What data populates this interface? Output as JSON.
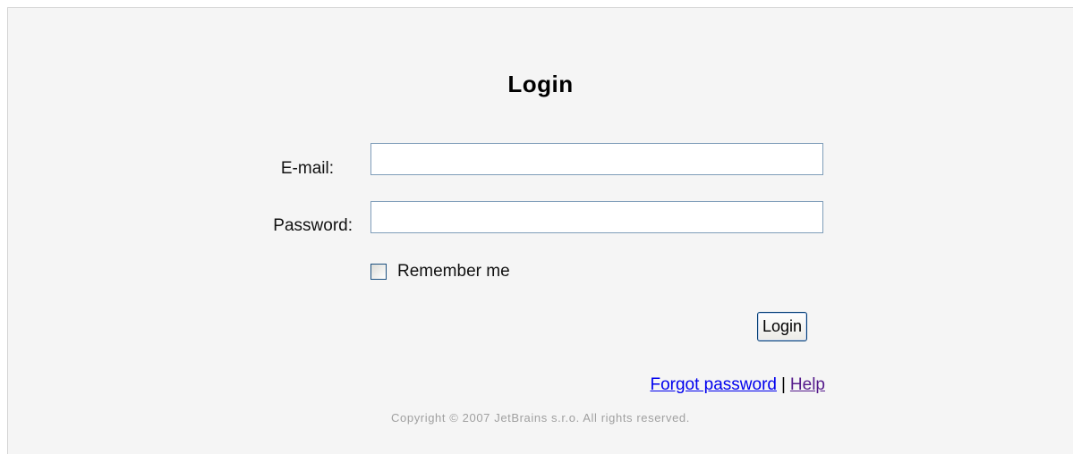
{
  "form": {
    "title": "Login",
    "email_label": "E-mail:",
    "email_value": "",
    "password_label": "Password:",
    "password_value": "",
    "remember_label": "Remember me",
    "remember_checked": false,
    "submit_label": "Login"
  },
  "links": {
    "forgot_password": "Forgot password",
    "separator": "|",
    "help": "Help"
  },
  "footer": {
    "copyright": "Copyright © 2007 JetBrains s.r.o. All rights reserved."
  },
  "colors": {
    "link": "#0000ee",
    "visited_link": "#551a8b",
    "panel_background": "#f5f5f5",
    "input_border": "#7f9db9"
  }
}
